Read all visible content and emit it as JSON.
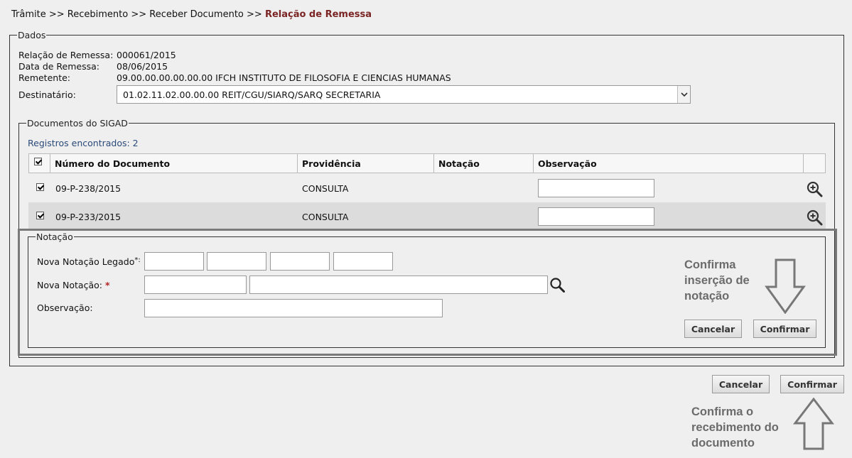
{
  "breadcrumb": {
    "parts": [
      "Trâmite >>",
      "Recebimento >>",
      "Receber Documento >>"
    ],
    "current": "Relação de Remessa"
  },
  "dados": {
    "legend": "Dados",
    "relacao_label": "Relação de Remessa:",
    "relacao_value": "000061/2015",
    "data_label": "Data de Remessa:",
    "data_value": "08/06/2015",
    "remetente_label": "Remetente:",
    "remetente_value": "09.00.00.00.00.00.00 IFCH INSTITUTO DE FILOSOFIA E CIENCIAS HUMANAS",
    "destinatario_label": "Destinatário:",
    "destinatario_value": "01.02.11.02.00.00.00 REIT/CGU/SIARQ/SARQ SECRETARIA"
  },
  "documentos": {
    "legend": "Documentos do SIGAD",
    "registros": "Registros encontrados: 2",
    "columns": [
      "Número do Documento",
      "Providência",
      "Notação",
      "Observação"
    ],
    "rows": [
      {
        "numero": "09-P-238/2015",
        "providencia": "CONSULTA",
        "notacao": ""
      },
      {
        "numero": "09-P-233/2015",
        "providencia": "CONSULTA",
        "notacao": ""
      }
    ]
  },
  "notacao": {
    "legend": "Notação",
    "legado_label": "Nova Notação Legado",
    "legado_suffix": "*:",
    "nova_label": "Nova Notação:",
    "required_mark": "*",
    "obs_label": "Observação:",
    "cancel_label": "Cancelar",
    "confirm_label": "Confirmar"
  },
  "footer": {
    "cancel_label": "Cancelar",
    "confirm_label": "Confirmar"
  },
  "annotations": {
    "notation_line1": "Confirma",
    "notation_line2": "inserção de",
    "notation_line3": "notação",
    "receipt_line1": "Confirma o",
    "receipt_line2": "recebimento do",
    "receipt_line3": "documento"
  },
  "colors": {
    "breadcrumb_current": "#7a2424",
    "registros": "#2a4a7a",
    "required": "#b22222",
    "annotation": "#6b6b6b"
  },
  "icons": [
    "chevron-down-icon",
    "zoom-in-icon",
    "search-icon",
    "down-arrow-icon",
    "up-arrow-icon"
  ]
}
